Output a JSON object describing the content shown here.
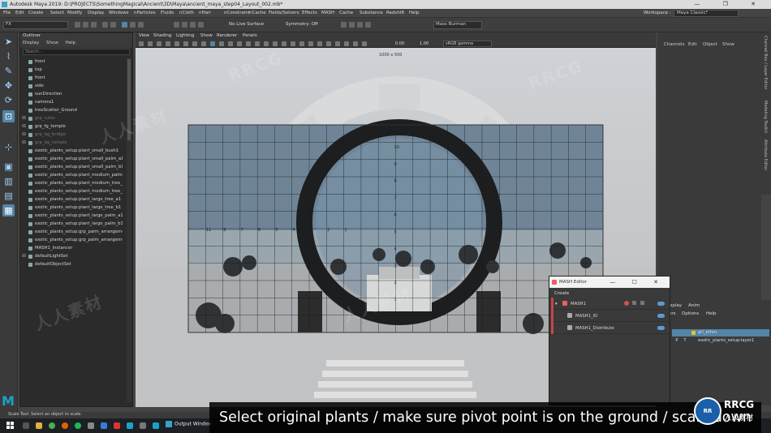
{
  "window": {
    "title": "Autodesk Maya 2019: D:\\PROJECTS\\SomethingMagical\\Ancient\\3D\\Maya\\ancient_maya_step04_Layout_002.mb*",
    "controls": "—  ❐  ✕"
  },
  "menubar": {
    "items": [
      "File",
      "Edit",
      "Create",
      "Select",
      "Modify",
      "Display",
      "Windows",
      "nParticles",
      "Fluids",
      "nCloth",
      "nHair",
      "nConstraint",
      "nCache",
      "Fields/Solvers",
      "Effects",
      "MASH",
      "Cache",
      "Substance",
      "Redshift",
      "Help"
    ],
    "workspace_label": "Workspace :",
    "workspace_value": "Maya Classic*"
  },
  "statusline": {
    "mode": "FX",
    "live_surface": "No Live Surface",
    "symmetry": "Symmetry: Off",
    "mass_select": "Mass Burman"
  },
  "outliner": {
    "title": "Outliner",
    "menu": [
      "Display",
      "Show",
      "Help"
    ],
    "search_placeholder": "Search...",
    "items": [
      {
        "label": "front",
        "dim": false,
        "expand": ""
      },
      {
        "label": "top",
        "dim": false,
        "expand": ""
      },
      {
        "label": "front",
        "dim": false,
        "expand": ""
      },
      {
        "label": "side",
        "dim": false,
        "expand": ""
      },
      {
        "label": "sunDirection",
        "dim": false,
        "expand": ""
      },
      {
        "label": "camera1",
        "dim": false,
        "expand": ""
      },
      {
        "label": "treeScatter_Ground",
        "dim": false,
        "expand": ""
      },
      {
        "label": "grp_ruins",
        "dim": true,
        "expand": "⊞"
      },
      {
        "label": "grp_fg_temple",
        "dim": false,
        "expand": "⊞"
      },
      {
        "label": "grp_bg_bridge",
        "dim": true,
        "expand": "⊞"
      },
      {
        "label": "grp_bg_temple",
        "dim": true,
        "expand": "⊞"
      },
      {
        "label": "exotic_plants_setup:plant_small_bush1",
        "dim": false,
        "expand": ""
      },
      {
        "label": "exotic_plants_setup:plant_small_palm_a1",
        "dim": false,
        "expand": ""
      },
      {
        "label": "exotic_plants_setup:plant_small_palm_b1",
        "dim": false,
        "expand": ""
      },
      {
        "label": "exotic_plants_setup:plant_medium_palm1",
        "dim": false,
        "expand": ""
      },
      {
        "label": "exotic_plants_setup:plant_medium_tree_a1",
        "dim": false,
        "expand": ""
      },
      {
        "label": "exotic_plants_setup:plant_medium_tree_b1",
        "dim": false,
        "expand": ""
      },
      {
        "label": "exotic_plants_setup:plant_large_tree_a1",
        "dim": false,
        "expand": ""
      },
      {
        "label": "exotic_plants_setup:plant_large_tree_b1",
        "dim": false,
        "expand": ""
      },
      {
        "label": "exotic_plants_setup:plant_large_palm_a1",
        "dim": false,
        "expand": ""
      },
      {
        "label": "exotic_plants_setup:plant_large_palm_b1",
        "dim": false,
        "expand": ""
      },
      {
        "label": "exotic_plants_setup:grp_palm_arrangement",
        "dim": false,
        "expand": ""
      },
      {
        "label": "exotic_plants_setup:grp_palm_arrangement",
        "dim": false,
        "expand": ""
      },
      {
        "label": "MASH1_Instancer",
        "dim": false,
        "expand": ""
      },
      {
        "label": "defaultLightSet",
        "dim": false,
        "expand": "⊞"
      },
      {
        "label": "defaultObjectSet",
        "dim": false,
        "expand": ""
      }
    ]
  },
  "viewport": {
    "menu": [
      "View",
      "Shading",
      "Lighting",
      "Show",
      "Renderer",
      "Panels"
    ],
    "field_a": "0.00",
    "field_b": "1.00",
    "color_space": "sRGB gamma",
    "resolution": "1000 x 500",
    "grid_numbers_top": [
      "11",
      "8",
      "7",
      "6",
      "5",
      "4",
      "3",
      "2",
      "1"
    ],
    "grid_numbers_side": [
      "11",
      "10",
      "9",
      "8",
      "7",
      "6",
      "5",
      "4",
      "3",
      "2",
      "1"
    ]
  },
  "channel_box": {
    "menu": [
      "Channels",
      "Edit",
      "Object",
      "Show"
    ],
    "side_tabs": [
      "Channel Box / Layer Editor",
      "Modeling Toolkit",
      "Attribute Editor"
    ]
  },
  "layer_editor": {
    "tabs": [
      "isplay",
      "Anim"
    ],
    "menu": [
      "ers",
      "Options",
      "Help"
    ],
    "rows": [
      {
        "p": "",
        "t": "",
        "name": "grl_ethm",
        "selected": true
      },
      {
        "p": "P",
        "t": "T",
        "name": "exotic_plants_setup:layer1",
        "selected": false
      }
    ]
  },
  "mash_editor": {
    "title": "MASH Editor",
    "controls": "—  ☐  ✕",
    "menu": "Create",
    "nodes": [
      {
        "name": "MASH1",
        "indent": 14
      },
      {
        "name": "MASH1_ID",
        "indent": 32
      },
      {
        "name": "MASH1_Distribute",
        "indent": 32
      }
    ]
  },
  "statusbar": {
    "text": "Scale Tool: Select an object to scale."
  },
  "taskbar": {
    "output_window": "Output Window"
  },
  "caption": {
    "text": "Select original plants / make sure pivot point is on the ground /   scale down"
  },
  "branding": {
    "logo_text": "RRCG",
    "logo_sub": "人人素材",
    "badge": "RR",
    "watermarks": [
      "RRCG",
      "人人素材"
    ]
  },
  "colors": {
    "accent": "#5285a6",
    "maya_logo": "#1aa3c9",
    "mash_red": "#c84545",
    "toggle_blue": "#5b9bd5"
  }
}
